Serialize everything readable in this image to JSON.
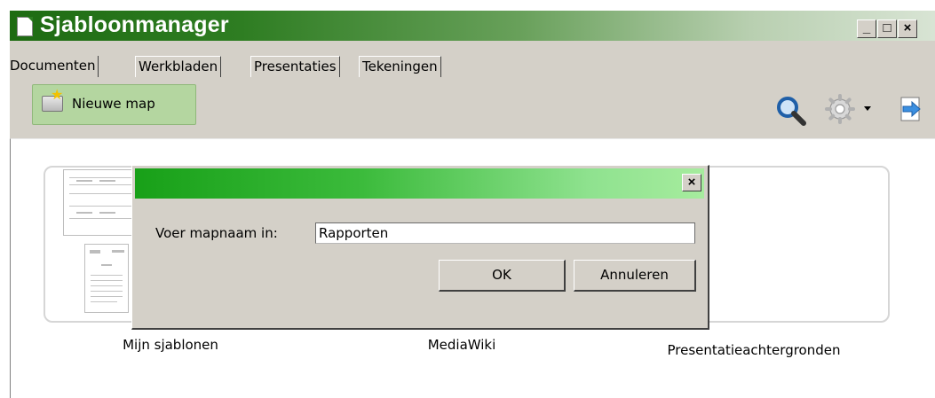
{
  "window": {
    "title": "Sjabloonmanager",
    "controls": {
      "minimize": "_",
      "maximize": "□",
      "close": "×"
    }
  },
  "tabs": [
    {
      "label": "Documenten",
      "active": true
    },
    {
      "label": "Werkbladen",
      "active": false
    },
    {
      "label": "Presentaties",
      "active": false
    },
    {
      "label": "Tekeningen",
      "active": false
    }
  ],
  "toolbar": {
    "new_folder_label": "Nieuwe map",
    "icons": [
      "search-icon",
      "settings-icon",
      "import-icon"
    ]
  },
  "folders": [
    {
      "label": "Mijn sjablonen"
    },
    {
      "label": "MediaWiki"
    },
    {
      "label": "Presentatieachtergronden"
    }
  ],
  "dialog": {
    "title": "",
    "close_glyph": "×",
    "prompt_label": "Voer mapnaam in:",
    "input_value": "Rapporten",
    "ok_label": "OK",
    "cancel_label": "Annuleren"
  },
  "colors": {
    "title_gradient_start": "#1e6b12",
    "dialog_gradient_start": "#18a018",
    "dialog_gradient_end": "#a6ec9e",
    "new_folder_button": "#b4d6a0",
    "face": "#d4d0c8"
  }
}
